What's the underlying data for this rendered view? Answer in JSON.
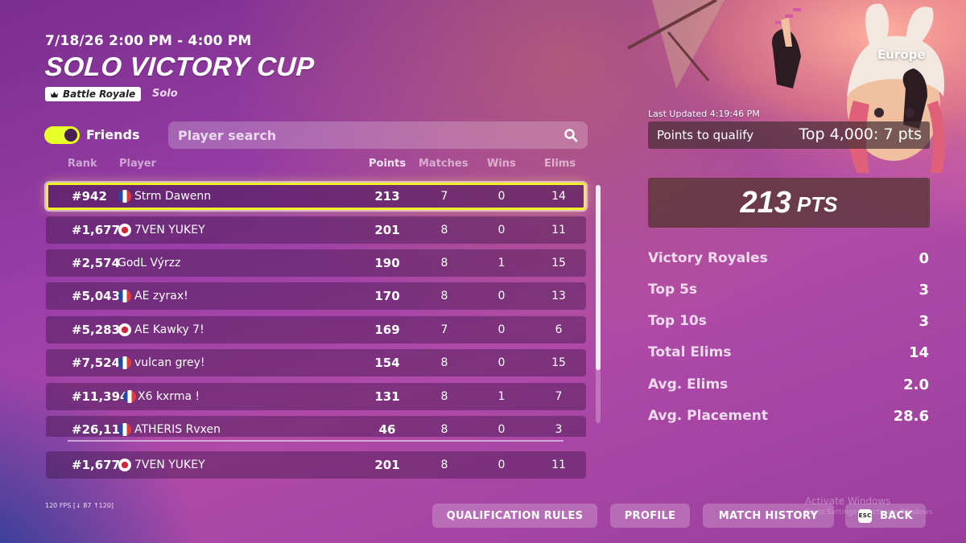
{
  "event": {
    "date_range": "7/18/26 2:00 PM - 4:00 PM",
    "title": "SOLO VICTORY CUP",
    "mode_tag": "Battle Royale",
    "mode_sub": "Solo"
  },
  "filters": {
    "friends_label": "Friends",
    "friends_toggle_on": true,
    "search_placeholder": "Player search"
  },
  "table": {
    "headers": {
      "rank": "Rank",
      "player": "Player",
      "points": "Points",
      "matches": "Matches",
      "wins": "Wins",
      "elims": "Elims"
    },
    "rows": [
      {
        "rank": "#942",
        "flag": "fr",
        "player": "Strm Dawenn",
        "points": "213",
        "matches": "7",
        "wins": "0",
        "elims": "14"
      },
      {
        "rank": "#1,677",
        "flag": "jp",
        "player": "7VEN YUKEY",
        "points": "201",
        "matches": "8",
        "wins": "0",
        "elims": "11"
      },
      {
        "rank": "#2,574",
        "flag": "none",
        "player": "GodL Výrzz",
        "points": "190",
        "matches": "8",
        "wins": "1",
        "elims": "15"
      },
      {
        "rank": "#5,043",
        "flag": "fr",
        "player": "AE zyrax!",
        "points": "170",
        "matches": "8",
        "wins": "0",
        "elims": "13"
      },
      {
        "rank": "#5,283",
        "flag": "jp",
        "player": "AE Kawky 7!",
        "points": "169",
        "matches": "7",
        "wins": "0",
        "elims": "6"
      },
      {
        "rank": "#7,524",
        "flag": "fr",
        "player": "vulcan grey!",
        "points": "154",
        "matches": "8",
        "wins": "0",
        "elims": "15"
      },
      {
        "rank": "#11,394",
        "flag": "fr",
        "player": "X6 kxrma !",
        "points": "131",
        "matches": "8",
        "wins": "1",
        "elims": "7"
      },
      {
        "rank": "#26,111",
        "flag": "fr",
        "player": "ATHERIS Rvxen",
        "points": "46",
        "matches": "8",
        "wins": "0",
        "elims": "3"
      }
    ],
    "pinned_row": {
      "rank": "#1,677",
      "flag": "jp",
      "player": "7VEN YUKEY",
      "points": "201",
      "matches": "8",
      "wins": "0",
      "elims": "11"
    }
  },
  "panel": {
    "region": "Europe",
    "last_updated": "Last Updated 4:19:46 PM",
    "qualify_label": "Points to qualify",
    "qualify_value": "Top 4,000: 7 pts",
    "total_points": "213",
    "points_unit": "PTS",
    "stats": [
      {
        "label": "Victory Royales",
        "value": "0"
      },
      {
        "label": "Top 5s",
        "value": "3"
      },
      {
        "label": "Top 10s",
        "value": "3"
      },
      {
        "label": "Total Elims",
        "value": "14"
      },
      {
        "label": "Avg. Elims",
        "value": "2.0"
      },
      {
        "label": "Avg. Placement",
        "value": "28.6"
      }
    ]
  },
  "footer": {
    "fps": "120 FPS [↓ 87 ↑120]",
    "buttons": {
      "qualification_rules": "QUALIFICATION RULES",
      "profile": "PROFILE",
      "match_history": "MATCH HISTORY",
      "back": "BACK",
      "esc": "ESC"
    },
    "watermark_line1": "Activate Windows",
    "watermark_line2": "Go to Settings to activate Windows."
  }
}
